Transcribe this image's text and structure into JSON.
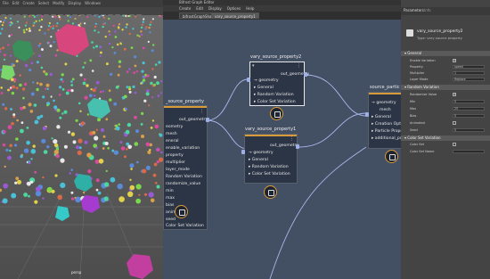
{
  "viewport": {
    "menu": [
      "File",
      "Edit",
      "Create",
      "Select",
      "Modify",
      "Display",
      "Windows"
    ],
    "camera": "persp"
  },
  "graph_editor": {
    "window_title": "Bifrost Graph Editor",
    "menu": [
      "Create",
      "Edit",
      "Display",
      "Options",
      "Help"
    ],
    "tabs": [
      "bifrostGraphShape1",
      "vary_source_property1"
    ],
    "nodes": {
      "left_partial": {
        "title": "_source_property",
        "output": "out_geometry",
        "inputs": [
          "eometry",
          "mesh",
          "eneral",
          "enable_variation",
          "property",
          "multiplier",
          "layer_mode",
          "Random Variation",
          "randomize_value",
          "min",
          "max",
          "bias",
          "animated",
          "seed",
          "Color Set Variation"
        ]
      },
      "vsp2": {
        "title": "vary_source_property2",
        "output": "out_geometry",
        "inputs": [
          "geometry",
          "General",
          "Random Variation",
          "Color Set Variation"
        ]
      },
      "vsp1": {
        "title": "vary_source_property1",
        "output": "out_geometry",
        "inputs": [
          "geometry",
          "General",
          "Random Variation",
          "Color Set Variation"
        ]
      },
      "particle": {
        "title": "source_partic",
        "inputs": [
          "geometry",
          "mesh",
          "General",
          "Creation Opt",
          "Particle Prope",
          "additional_pr"
        ]
      }
    }
  },
  "attribute_editor": {
    "tabs": [
      "Parameters",
      "Info"
    ],
    "node_name": "vary_source_property2",
    "node_type": "Type: vary source property",
    "sections": [
      {
        "title": "General",
        "rows": [
          {
            "label": "Enable Variation",
            "type": "check",
            "value": "✓"
          },
          {
            "label": "Property",
            "type": "field",
            "value": "speed"
          },
          {
            "label": "Multiplier",
            "type": "field",
            "value": "1"
          },
          {
            "label": "Layer Mode",
            "type": "field",
            "value": "Replace"
          }
        ]
      },
      {
        "title": "Random Variation",
        "rows": [
          {
            "label": "Randomize Value",
            "type": "check",
            "value": "✓"
          },
          {
            "label": "Min",
            "type": "field",
            "value": "0"
          },
          {
            "label": "Max",
            "type": "field",
            "value": "25"
          },
          {
            "label": "Bias",
            "type": "field",
            "value": "0"
          },
          {
            "label": "Animated",
            "type": "check",
            "value": ""
          },
          {
            "label": "Seed",
            "type": "field",
            "value": "0"
          }
        ]
      },
      {
        "title": "Color Set Variation",
        "rows": [
          {
            "label": "Color Set",
            "type": "check",
            "value": ""
          },
          {
            "label": "Color Set Name",
            "type": "field",
            "value": ""
          }
        ]
      }
    ]
  }
}
